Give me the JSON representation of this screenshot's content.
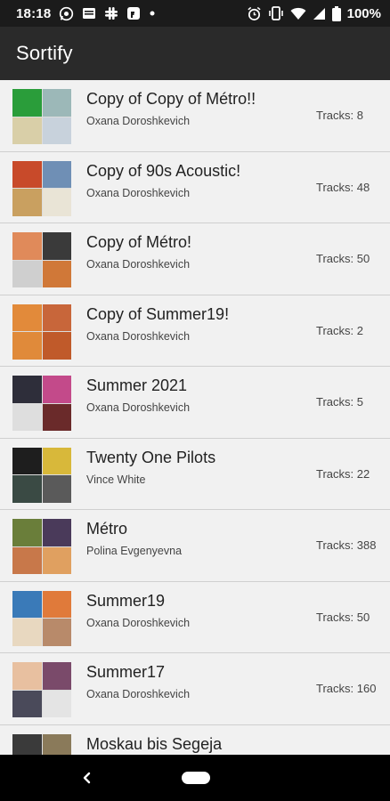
{
  "status_bar": {
    "time": "18:18",
    "battery": "100%",
    "icons_left": [
      "whatsapp-icon",
      "news-icon",
      "slack-icon",
      "fb-messenger-icon",
      "dot-icon"
    ],
    "icons_right": [
      "alarm-icon",
      "vibrate-icon",
      "wifi-icon",
      "signal-icon",
      "battery-icon"
    ]
  },
  "app_bar": {
    "title": "Sortify"
  },
  "playlists": [
    {
      "name": "Copy of Copy of Métro!!",
      "owner": "Oxana Doroshkevich",
      "tracks": "Tracks: 8",
      "cover": [
        "#2a9d3a",
        "#9cb8b8",
        "#d9cfa8",
        "#c8d2dc"
      ]
    },
    {
      "name": "Copy of 90s Acoustic!",
      "owner": "Oxana Doroshkevich",
      "tracks": "Tracks: 48",
      "cover": [
        "#c84a2a",
        "#6f8fb5",
        "#c9a060",
        "#e9e4d6"
      ]
    },
    {
      "name": "Copy of Métro!",
      "owner": "Oxana Doroshkevich",
      "tracks": "Tracks: 50",
      "cover": [
        "#e08a5a",
        "#3a3a3a",
        "#cfcfcf",
        "#d07838"
      ]
    },
    {
      "name": "Copy of Summer19!",
      "owner": "Oxana Doroshkevich",
      "tracks": "Tracks: 2",
      "cover": [
        "#e28a3a",
        "#c8663a",
        "#e08a3a",
        "#c05a2a"
      ]
    },
    {
      "name": "Summer 2021",
      "owner": "Oxana Doroshkevich",
      "tracks": "Tracks: 5",
      "cover": [
        "#2e2e3a",
        "#c34a8a",
        "#dedede",
        "#6a2a2a"
      ]
    },
    {
      "name": "Twenty One Pilots",
      "owner": "Vince White",
      "tracks": "Tracks: 22",
      "cover": [
        "#1e1e1e",
        "#d8b83a",
        "#3a4a44",
        "#5a5a5a"
      ]
    },
    {
      "name": "Métro",
      "owner": "Polina Evgenyevna",
      "tracks": "Tracks: 388",
      "cover": [
        "#6a7e3a",
        "#4a3a5a",
        "#c8784a",
        "#e0a060"
      ]
    },
    {
      "name": "Summer19",
      "owner": "Oxana Doroshkevich",
      "tracks": "Tracks: 50",
      "cover": [
        "#3a7ab8",
        "#e07a3a",
        "#e8d8c0",
        "#b88a6a"
      ]
    },
    {
      "name": "Summer17",
      "owner": "Oxana Doroshkevich",
      "tracks": "Tracks: 160",
      "cover": [
        "#e8c0a0",
        "#7a4a6a",
        "#4a4a5a",
        "#e4e4e4"
      ]
    },
    {
      "name": "Moskau bis Segeja",
      "owner": "",
      "tracks": "",
      "cover": [
        "#3a3a3a",
        "#8a7a5a",
        "#5a5a5a",
        "#9a8a6a"
      ]
    }
  ],
  "nav_bar": {
    "back_icon": "back-chevron-icon",
    "home_icon": "home-pill-icon"
  }
}
